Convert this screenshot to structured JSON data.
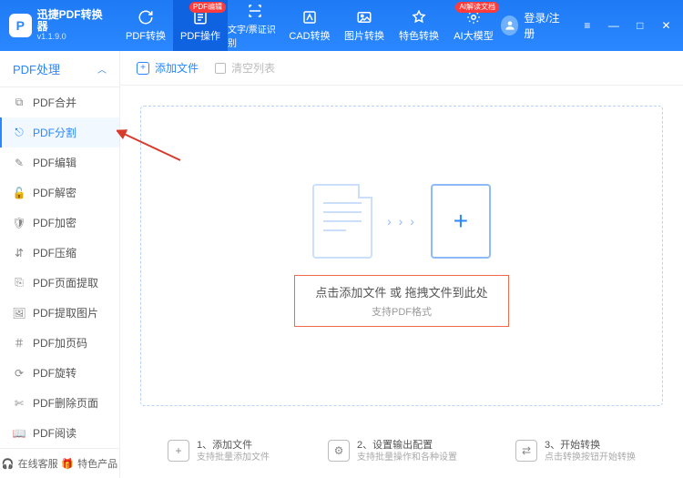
{
  "app": {
    "title": "迅捷PDF转换器",
    "version": "v1.1.9.0"
  },
  "tabs": [
    {
      "label": "PDF转换",
      "badge": ""
    },
    {
      "label": "PDF操作",
      "badge": "PDF编辑"
    },
    {
      "label": "文字/票证识别",
      "badge": ""
    },
    {
      "label": "CAD转换",
      "badge": ""
    },
    {
      "label": "图片转换",
      "badge": ""
    },
    {
      "label": "特色转换",
      "badge": ""
    },
    {
      "label": "AI大模型",
      "badge": "AI解读文档"
    }
  ],
  "login": {
    "label": "登录/注册"
  },
  "sidebar": {
    "section": "PDF处理",
    "items": [
      {
        "label": "PDF合并"
      },
      {
        "label": "PDF分割"
      },
      {
        "label": "PDF编辑"
      },
      {
        "label": "PDF解密"
      },
      {
        "label": "PDF加密"
      },
      {
        "label": "PDF压缩"
      },
      {
        "label": "PDF页面提取"
      },
      {
        "label": "PDF提取图片"
      },
      {
        "label": "PDF加页码"
      },
      {
        "label": "PDF旋转"
      },
      {
        "label": "PDF删除页面"
      },
      {
        "label": "PDF阅读"
      }
    ],
    "footer": {
      "support": "在线客服",
      "featured": "特色产品"
    }
  },
  "toolbar": {
    "add": "添加文件",
    "clear": "清空列表"
  },
  "dropzone": {
    "line1": "点击添加文件 或 拖拽文件到此处",
    "line2": "支持PDF格式"
  },
  "steps": [
    {
      "title": "1、添加文件",
      "sub": "支持批量添加文件"
    },
    {
      "title": "2、设置输出配置",
      "sub": "支持批量操作和各种设置"
    },
    {
      "title": "3、开始转换",
      "sub": "点击转换按钮开始转换"
    }
  ]
}
